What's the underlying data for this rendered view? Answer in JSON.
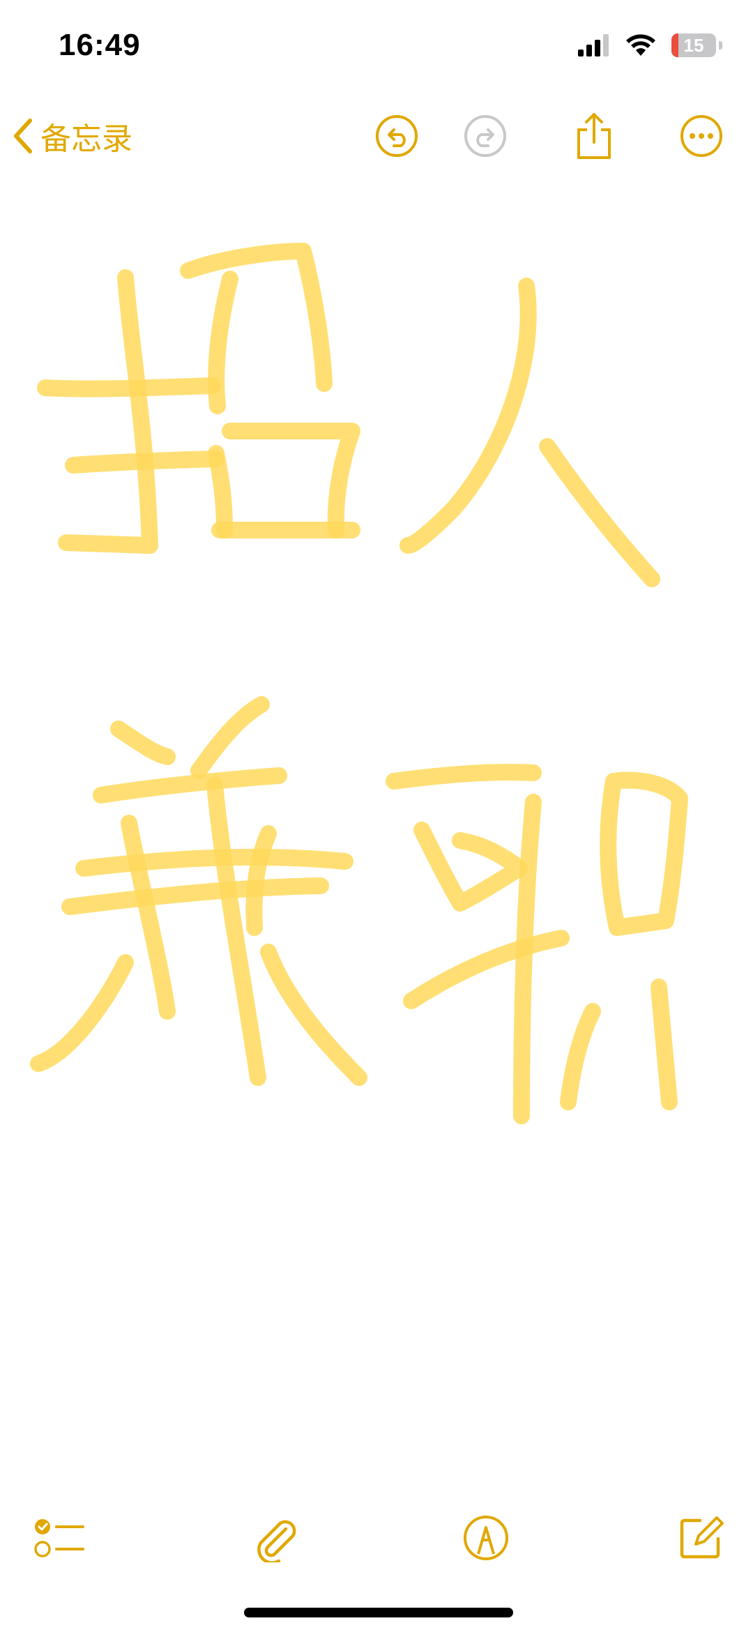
{
  "status_bar": {
    "time": "16:49",
    "battery_level": "15"
  },
  "nav": {
    "back_label": "备忘录"
  },
  "colors": {
    "accent": "#e0a800",
    "ink": "#ffd95c",
    "disabled": "#c8c8c8"
  },
  "icons": {
    "back": "chevron-left-icon",
    "undo": "undo-icon",
    "redo": "redo-icon",
    "share": "share-icon",
    "more": "ellipsis-icon",
    "checklist": "checklist-icon",
    "attach": "paperclip-icon",
    "markup": "markup-pen-icon",
    "compose": "compose-icon"
  }
}
